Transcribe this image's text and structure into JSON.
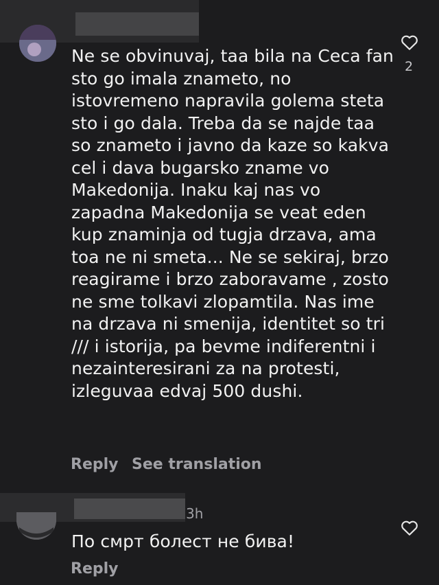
{
  "comment1": {
    "text": "Ne se obvinuvaj, taa bila na Ceca fan sto go imala znameto, no istovremeno napravila golema steta sto i go dala. Treba da se najde taa so znameto i javno da kaze so kakva cel i dava bugarsko zname vo Makedonija. Inaku kaj nas vo zapadna Makedonija se veat eden kup znaminja od tugja drzava, ama toa ne ni smeta... Ne se sekiraj, brzo reagirame i brzo zaboravame , zosto ne sme tolkavi zlopamtila. Nas ime na drzava ni smenija, identitet so tri /// i istorija, pa bevme indiferentni i nezainteresirani za na protesti, izleguvaa edvaj 500 dushi.",
    "like_count": "2",
    "reply_label": "Reply",
    "translate_label": "See translation"
  },
  "comment2": {
    "time": "3h",
    "text": "По смрт болест не бива!",
    "reply_label": "Reply"
  },
  "icons": {
    "like": "heart-outline-icon"
  },
  "colors": {
    "background": "#1c1c1e",
    "text": "#f2f2f2",
    "secondary": "#a0a0a5"
  }
}
